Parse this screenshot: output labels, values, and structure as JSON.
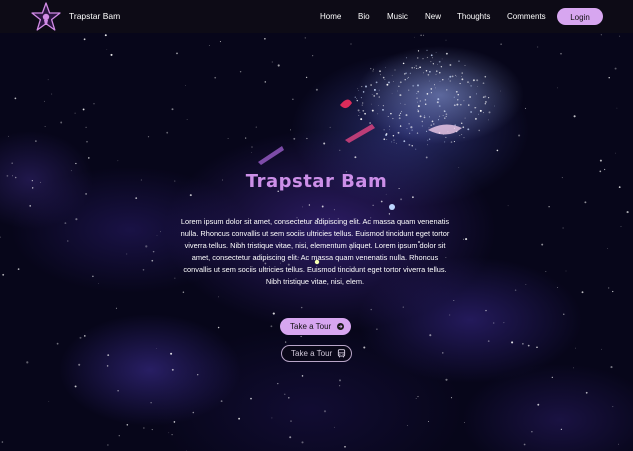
{
  "nav": {
    "brand": "Trapstar Bam",
    "links": [
      "Home",
      "Bio",
      "Music",
      "New",
      "Thoughts",
      "Comments"
    ],
    "login_label": "Login",
    "logo_icon": "star-logo-icon"
  },
  "hero": {
    "title": "Trapstar Bam",
    "body": "Lorem ipsum dolor sit amet, consectetur adipiscing elit. Ac massa quam venenatis nulla. Rhoncus convallis ut sem sociis ultricies tellus. Euismod tincidunt eget tortor viverra tellus. Nibh tristique vitae, nisi, elementum aliquet. Lorem ipsum dolor sit amet, consectetur adipiscing elit. Ac massa quam venenatis nulla. Rhoncus convallis ut sem sociis ultricies tellus. Euismod tincidunt eget tortor viverra tellus. Nibh tristique vitae, nisi, elem.",
    "primary_button": {
      "label": "Take a Tour",
      "icon": "arrow-circle-right-icon"
    },
    "secondary_button": {
      "label": "Take a Tour",
      "icon": "bus-icon"
    }
  },
  "colors": {
    "accent": "#d7a6f0",
    "title": "#cc8fe8",
    "navbar": "#0e0c16",
    "background": "#07061a"
  }
}
